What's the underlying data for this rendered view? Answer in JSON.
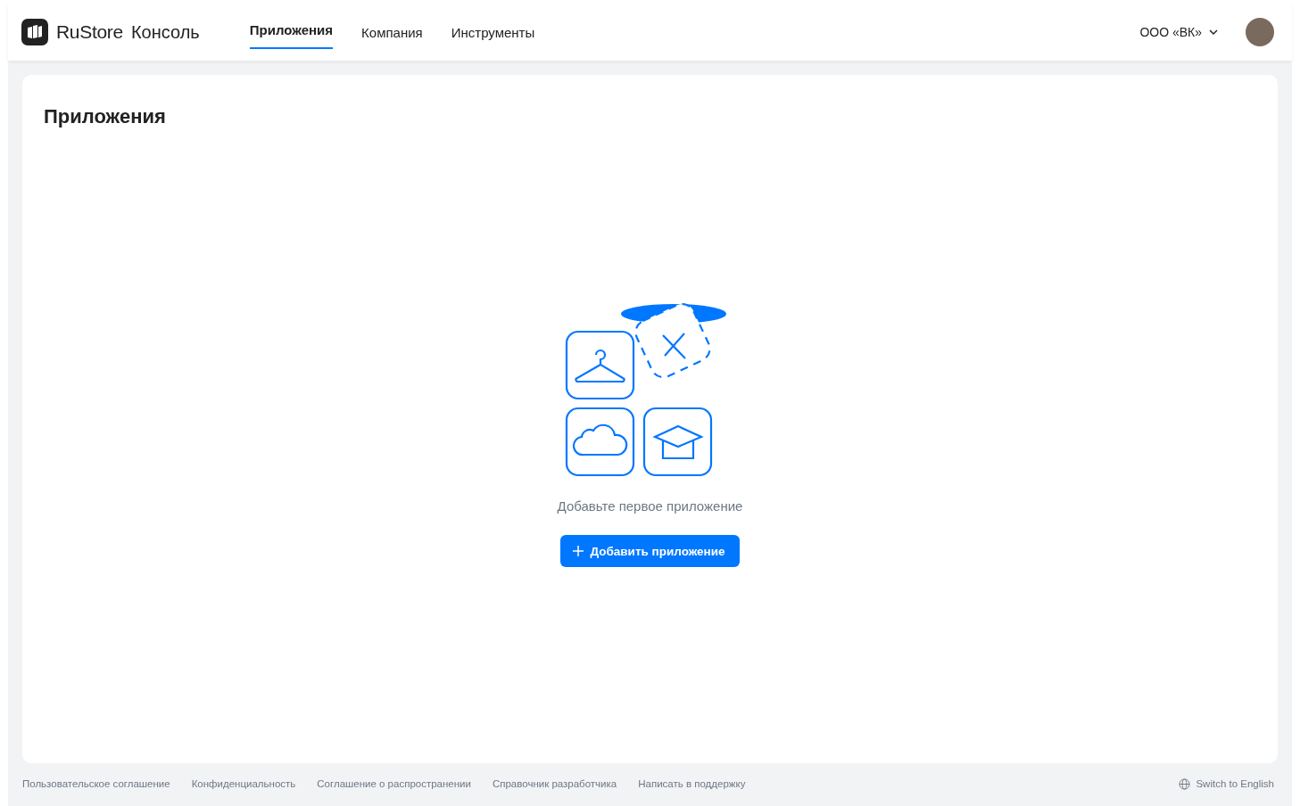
{
  "header": {
    "brand": "RuStore",
    "product": "Консоль",
    "nav": [
      {
        "label": "Приложения",
        "selected": true
      },
      {
        "label": "Компания",
        "selected": false
      },
      {
        "label": "Инструменты",
        "selected": false
      }
    ],
    "company": "ООО «ВК»"
  },
  "page": {
    "title": "Приложения",
    "empty_text": "Добавьте первое приложение",
    "add_button": "Добавить приложение"
  },
  "footer": {
    "links": [
      "Пользовательское соглашение",
      "Конфиденциальность",
      "Соглашение о распространении",
      "Справочник разработчика",
      "Написать в поддержку"
    ],
    "language": "Switch to English"
  }
}
